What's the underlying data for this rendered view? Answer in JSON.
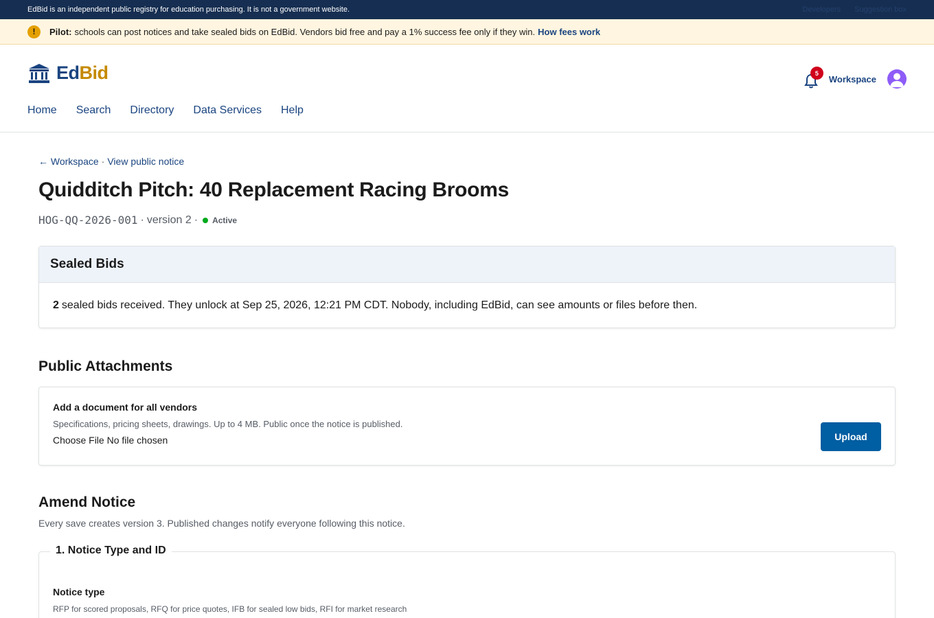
{
  "banner": {
    "text": "EdBid is an independent public registry for education purchasing. It is not a government website.",
    "links": [
      "Developers",
      "Suggestion box"
    ]
  },
  "alert": {
    "icon": "exclamation-icon",
    "bold": "Pilot:",
    "text": "schools can post notices and take sealed bids on EdBid. Vendors bid free and pay a 1% success fee only if they win.",
    "link": "How fees work"
  },
  "header": {
    "logo_ed": "Ed",
    "logo_bid": "Bid",
    "logo_icon": "bank-building-icon",
    "notification_count": "5",
    "workspace_label": "Workspace",
    "nav": [
      "Home",
      "Search",
      "Directory",
      "Data Services",
      "Help"
    ]
  },
  "breadcrumb": {
    "arrow": "←",
    "workspace": "Workspace",
    "sep": "·",
    "view_notice": "View public notice"
  },
  "notice": {
    "title": "Quidditch Pitch: 40 Replacement Racing Brooms",
    "id": "HOG-QQ-2026-001",
    "sep": "·",
    "version": "version 2",
    "status": "Active",
    "status_color": "#00a91c"
  },
  "sealed": {
    "title": "Sealed Bids",
    "count": "2",
    "text": "sealed bids received. They unlock at Sep 25, 2026, 12:21 PM CDT. Nobody, including EdBid, can see amounts or files before then."
  },
  "attachments": {
    "title": "Public Attachments",
    "label": "Add a document for all vendors",
    "hint": "Specifications, pricing sheets, drawings. Up to 4 MB. Public once the notice is published.",
    "file_input": "Choose File No file chosen",
    "upload": "Upload"
  },
  "amend": {
    "title": "Amend Notice",
    "subtitle": "Every save creates version 3. Published changes notify everyone following this notice.",
    "section_1": "1. Notice Type and ID",
    "field_label": "Notice type",
    "field_hint": "RFP for scored proposals, RFQ for price quotes, IFB for sealed low bids, RFI for market research"
  },
  "colors": {
    "navy": "#162e51",
    "link": "#1a4480",
    "primary_button": "#005ea2",
    "gold": "#c58a00",
    "alert_bg": "#fff5e0",
    "badge": "#d0021b"
  }
}
